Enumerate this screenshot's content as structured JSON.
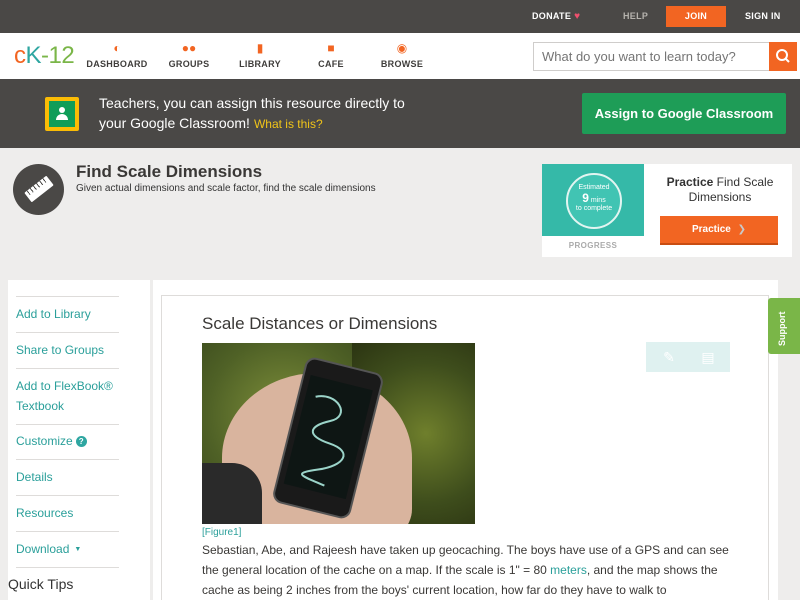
{
  "topbar": {
    "donate": "DONATE",
    "help": "HELP",
    "join": "JOIN",
    "sign_in": "SIGN IN"
  },
  "nav": {
    "logo": {
      "c": "c",
      "k": "K",
      "n": "-12"
    },
    "items": [
      {
        "label": "DASHBOARD",
        "icon": "dashboard-icon"
      },
      {
        "label": "GROUPS",
        "icon": "groups-icon"
      },
      {
        "label": "LIBRARY",
        "icon": "library-icon"
      },
      {
        "label": "CAFE",
        "icon": "cafe-icon"
      },
      {
        "label": "BROWSE",
        "icon": "browse-icon"
      }
    ],
    "search_placeholder": "What do you want to learn today?"
  },
  "classroom": {
    "line1": "Teachers, you can assign this resource directly to",
    "line2": "your Google Classroom!",
    "link": "What is this?",
    "button": "Assign to Google Classroom"
  },
  "concept": {
    "title": "Find Scale Dimensions",
    "description": "Given actual dimensions and scale factor, find the scale dimensions"
  },
  "practice": {
    "estimated": "Estimated",
    "mins_number": "9",
    "mins_unit": "mins",
    "to_complete": "to complete",
    "progress": "PROGRESS",
    "title_bold": "Practice",
    "title_rest": "Find Scale Dimensions",
    "button": "Practice"
  },
  "sidebar": {
    "items": [
      {
        "label": "Add to Library"
      },
      {
        "label": "Share to Groups"
      },
      {
        "label": "Add to FlexBook® Textbook"
      },
      {
        "label": "Customize"
      },
      {
        "label": "Details"
      },
      {
        "label": "Resources"
      },
      {
        "label": "Download"
      }
    ],
    "quick_tips": "Quick Tips"
  },
  "content": {
    "section_title": "Scale Distances or Dimensions",
    "figure_caption": "[Figure1]",
    "paragraph_part1": "Sebastian, Abe, and Rajeesh have taken up geocaching. The boys have use of a GPS and can see the general location of the cache on a map. If the scale is 1\" = 80 ",
    "paragraph_link": "meters",
    "paragraph_part2": ", and the map shows the cache as being 2 inches from the boys' current location, how far do they have to walk to"
  },
  "support": "Support",
  "colors": {
    "brand_orange": "#f26522",
    "brand_teal": "#2ea6a1",
    "brand_green": "#7ab648",
    "classroom_green": "#1e9d57",
    "dark_bar": "#4a4846"
  }
}
